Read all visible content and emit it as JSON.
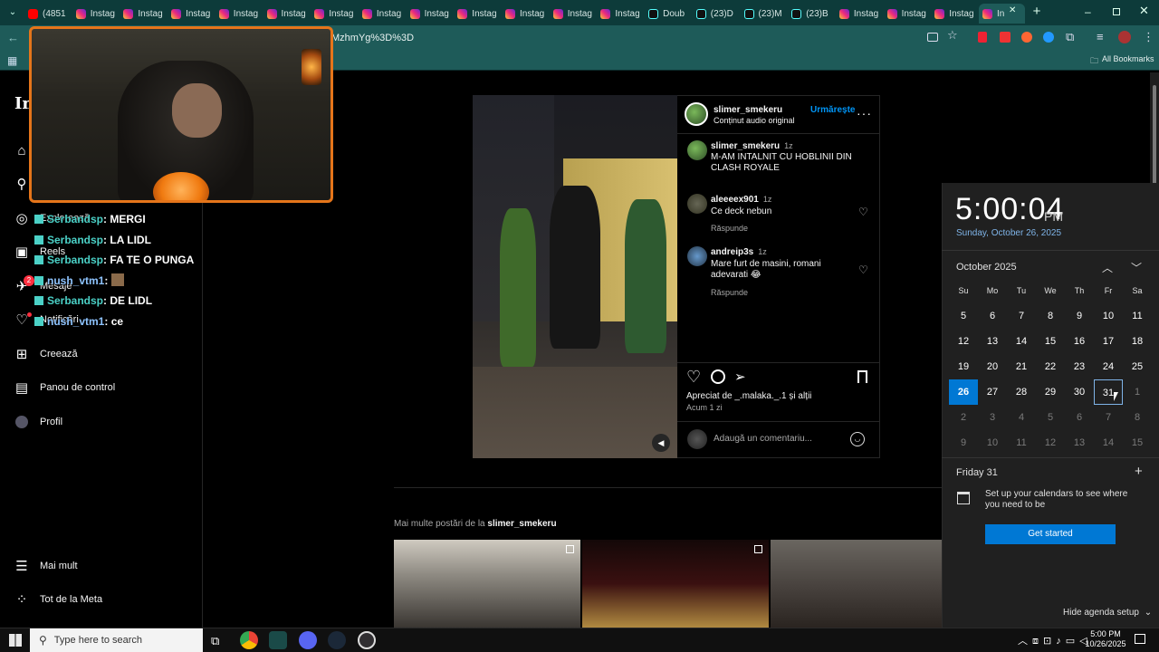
{
  "browser": {
    "tabs": [
      {
        "label": "(4851",
        "kind": "yt"
      },
      {
        "label": "Instag",
        "kind": "ig"
      },
      {
        "label": "Instag",
        "kind": "ig"
      },
      {
        "label": "Instag",
        "kind": "ig"
      },
      {
        "label": "Instag",
        "kind": "ig"
      },
      {
        "label": "Instag",
        "kind": "ig"
      },
      {
        "label": "Instag",
        "kind": "ig"
      },
      {
        "label": "Instag",
        "kind": "ig"
      },
      {
        "label": "Instag",
        "kind": "ig"
      },
      {
        "label": "Instag",
        "kind": "ig"
      },
      {
        "label": "Instag",
        "kind": "ig"
      },
      {
        "label": "Instag",
        "kind": "ig"
      },
      {
        "label": "Instag",
        "kind": "ig"
      },
      {
        "label": "Doub",
        "kind": "tt"
      },
      {
        "label": "(23)D",
        "kind": "tt"
      },
      {
        "label": "(23)M",
        "kind": "tt"
      },
      {
        "label": "(23)B",
        "kind": "tt"
      },
      {
        "label": "Instag",
        "kind": "ig"
      },
      {
        "label": "Instag",
        "kind": "ig"
      },
      {
        "label": "Instag",
        "kind": "ig"
      },
      {
        "label": "In",
        "kind": "ig"
      }
    ],
    "url": "MzhmYg%3D%3D",
    "all_bookmarks": "All Bookmarks"
  },
  "nav": {
    "explore": "Explorează",
    "reels": "Reels",
    "messages": "Mesaje",
    "messages_badge": "2",
    "notifications": "Notificări",
    "create": "Creează",
    "dashboard": "Panou de control",
    "profile": "Profil",
    "more": "Mai mult",
    "meta": "Tot de la Meta"
  },
  "chat": [
    {
      "user": "Serbandsp",
      "msg": "MERGI",
      "color": "teal"
    },
    {
      "user": "Serbandsp",
      "msg": "LA LIDL",
      "color": "teal"
    },
    {
      "user": "Serbandsp",
      "msg": "FA TE O PUNGA",
      "color": "teal"
    },
    {
      "user": "nush_vtm1",
      "msg": "",
      "color": "blue"
    },
    {
      "user": "Serbandsp",
      "msg": "DE LIDL",
      "color": "teal"
    },
    {
      "user": "nush_vtm1",
      "msg": "ce",
      "color": "blue"
    }
  ],
  "post": {
    "author": "slimer_smekeru",
    "follow": "Urmărește",
    "audio": "Conținut audio original",
    "caption_user": "slimer_smekeru",
    "caption_time": "1z",
    "caption": "M-AM INTALNIT CU HOBLINII DIN CLASH ROYALE",
    "comments": [
      {
        "user": "aleeeex901",
        "time": "1z",
        "text": "Ce deck nebun",
        "reply": "Răspunde"
      },
      {
        "user": "andreip3s",
        "time": "1z",
        "text": "Mare furt de masini, romani adevarati 😂",
        "reply": "Răspunde"
      }
    ],
    "liked_by": "Apreciat de _.malaka._.1 și alții",
    "posted": "Acum 1 zi",
    "comment_placeholder": "Adaugă un comentariu..."
  },
  "more_posts": {
    "prefix": "Mai multe postări de la ",
    "user": "slimer_smekeru"
  },
  "calendar": {
    "time": "5:00:04",
    "ampm": "PM",
    "date_long": "Sunday, October 26, 2025",
    "month": "October 2025",
    "weekdays": [
      "Su",
      "Mo",
      "Tu",
      "We",
      "Th",
      "Fr",
      "Sa"
    ],
    "weeks": [
      [
        "5",
        "6",
        "7",
        "8",
        "9",
        "10",
        "11"
      ],
      [
        "12",
        "13",
        "14",
        "15",
        "16",
        "17",
        "18"
      ],
      [
        "19",
        "20",
        "21",
        "22",
        "23",
        "24",
        "25"
      ],
      [
        "26",
        "27",
        "28",
        "29",
        "30",
        "31",
        "1"
      ],
      [
        "2",
        "3",
        "4",
        "5",
        "6",
        "7",
        "8"
      ],
      [
        "9",
        "10",
        "11",
        "12",
        "13",
        "14",
        "15"
      ]
    ],
    "agenda_day": "Friday 31",
    "setup_text": "Set up your calendars to see where you need to be",
    "get_started": "Get started",
    "hide_agenda": "Hide agenda setup"
  },
  "taskbar": {
    "search_placeholder": "Type here to search",
    "time": "5:00 PM",
    "date": "10/26/2025"
  },
  "colors": {
    "browser_frame": "#1e5b59",
    "ig_link": "#0095f6",
    "win_accent": "#0078d4",
    "cam_border": "#e5751a"
  }
}
